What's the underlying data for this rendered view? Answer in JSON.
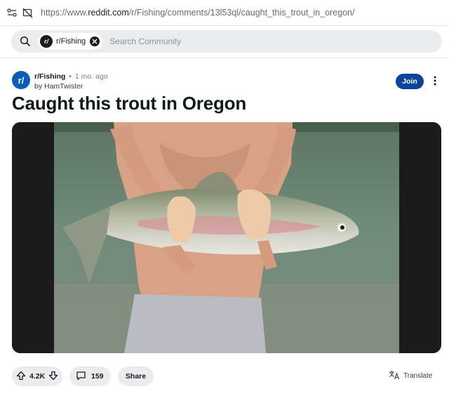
{
  "browser": {
    "url_prefix": "https://www.",
    "url_domain": "reddit.com",
    "url_path": "/r/Fishing/comments/13l53ql/caught_this_trout_in_oregon/"
  },
  "search": {
    "chip_label": "r/Fishing",
    "chip_avatar": "r/",
    "placeholder": "Search Community"
  },
  "post": {
    "subreddit": "r/Fishing",
    "separator": "•",
    "age": "1 mo. ago",
    "author_line": "by HamTwister",
    "avatar_text": "r/",
    "join_label": "Join",
    "title": "Caught this trout in Oregon"
  },
  "actions": {
    "upvotes": "4.2K",
    "comments": "159",
    "share_label": "Share",
    "translate_label": "Translate"
  },
  "colors": {
    "join": "#0a449b",
    "avatar": "#0b5eb8",
    "pill": "#eaedef"
  },
  "icons": [
    "site-info-icon",
    "tracking-blocked-icon",
    "search-icon",
    "close-icon",
    "more-options-icon",
    "upvote-icon",
    "downvote-icon",
    "comment-icon",
    "translate-icon"
  ]
}
